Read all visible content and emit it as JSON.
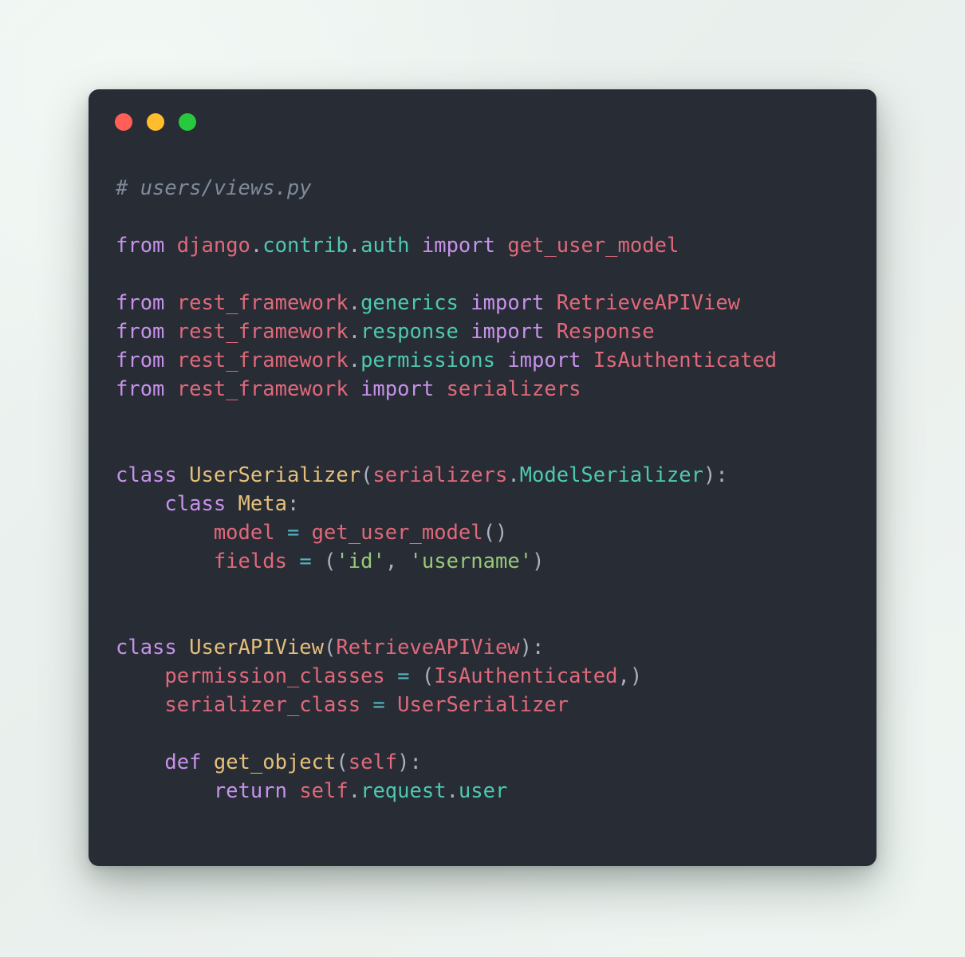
{
  "window": {
    "name": "code-snippet-window",
    "background_color": "#282c35",
    "traffic_lights": [
      {
        "name": "close-button",
        "color": "#ff5f56"
      },
      {
        "name": "minimize-button",
        "color": "#ffbd2e"
      },
      {
        "name": "maximize-button",
        "color": "#27c93f"
      }
    ]
  },
  "page": {
    "background_gradient_start": "#eef4f1",
    "background_gradient_end": "#e9efec"
  },
  "code": {
    "language": "python",
    "filename_comment": "# users/views.py",
    "theme_colors": {
      "comment": "#7f8a9b",
      "keyword": "#c792ea",
      "module": "#e0697a",
      "attribute": "#4ec9b0",
      "class_name": "#e5c07b",
      "function_name": "#e5c07b",
      "string": "#97c978",
      "operator": "#56b6c2",
      "punctuation": "#abb2bf",
      "default_text": "#c8ccd4"
    },
    "plain_text": "# users/views.py\n\nfrom django.contrib.auth import get_user_model\n\nfrom rest_framework.generics import RetrieveAPIView\nfrom rest_framework.response import Response\nfrom rest_framework.permissions import IsAuthenticated\nfrom rest_framework import serializers\n\n\nclass UserSerializer(serializers.ModelSerializer):\n    class Meta:\n        model = get_user_model()\n        fields = ('id', 'username')\n\n\nclass UserAPIView(RetrieveAPIView):\n    permission_classes = (IsAuthenticated,)\n    serializer_class = UserSerializer\n\n    def get_object(self):\n        return self.request.user",
    "lines": [
      {
        "n": 1,
        "text": "# users/views.py"
      },
      {
        "n": 2,
        "text": ""
      },
      {
        "n": 3,
        "text": "from django.contrib.auth import get_user_model"
      },
      {
        "n": 4,
        "text": ""
      },
      {
        "n": 5,
        "text": "from rest_framework.generics import RetrieveAPIView"
      },
      {
        "n": 6,
        "text": "from rest_framework.response import Response"
      },
      {
        "n": 7,
        "text": "from rest_framework.permissions import IsAuthenticated"
      },
      {
        "n": 8,
        "text": "from rest_framework import serializers"
      },
      {
        "n": 9,
        "text": ""
      },
      {
        "n": 10,
        "text": ""
      },
      {
        "n": 11,
        "text": "class UserSerializer(serializers.ModelSerializer):"
      },
      {
        "n": 12,
        "text": "    class Meta:"
      },
      {
        "n": 13,
        "text": "        model = get_user_model()"
      },
      {
        "n": 14,
        "text": "        fields = ('id', 'username')"
      },
      {
        "n": 15,
        "text": ""
      },
      {
        "n": 16,
        "text": ""
      },
      {
        "n": 17,
        "text": "class UserAPIView(RetrieveAPIView):"
      },
      {
        "n": 18,
        "text": "    permission_classes = (IsAuthenticated,)"
      },
      {
        "n": 19,
        "text": "    serializer_class = UserSerializer"
      },
      {
        "n": 20,
        "text": ""
      },
      {
        "n": 21,
        "text": "    def get_object(self):"
      },
      {
        "n": 22,
        "text": "        return self.request.user"
      }
    ],
    "tokens": {
      "keywords": [
        "from",
        "import",
        "class",
        "def",
        "return"
      ],
      "modules": [
        "django",
        "rest_framework",
        "get_user_model",
        "RetrieveAPIView",
        "Response",
        "IsAuthenticated",
        "serializers",
        "self"
      ],
      "attributes": [
        "contrib",
        "auth",
        "generics",
        "response",
        "permissions",
        "ModelSerializer",
        "request",
        "user"
      ],
      "class_names": [
        "UserSerializer",
        "Meta",
        "UserAPIView"
      ],
      "function_names": [
        "get_object"
      ],
      "variables": [
        "model",
        "fields",
        "permission_classes",
        "serializer_class"
      ],
      "strings": [
        "'id'",
        "'username'"
      ]
    }
  }
}
